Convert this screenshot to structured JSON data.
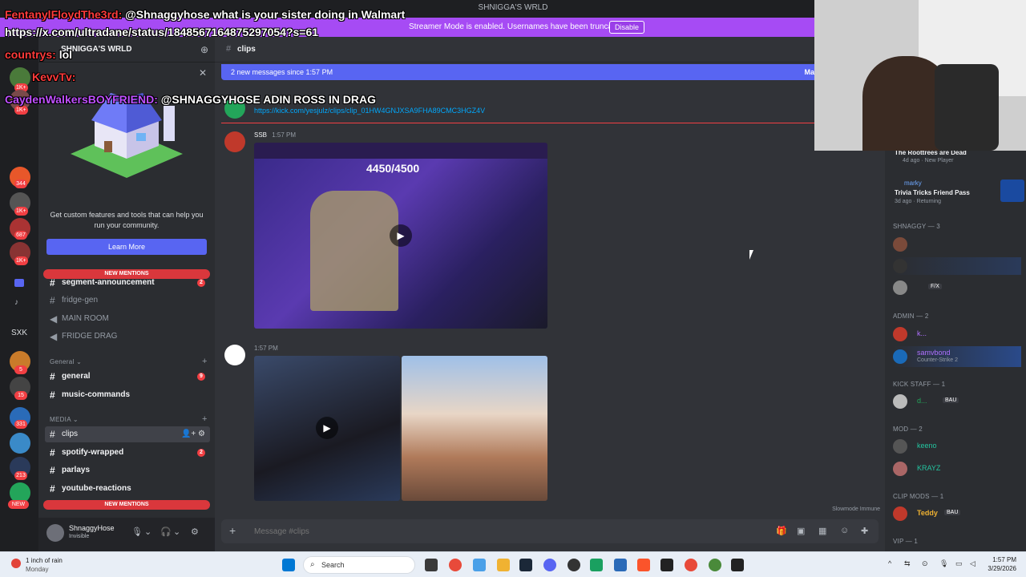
{
  "window": {
    "title": "SHNIGGA'S WRLD"
  },
  "streamer_banner": {
    "text": "Streamer Mode is enabled. Usernames have been truncated.",
    "button": "Disable"
  },
  "overlay_chat": [
    {
      "user": "FentanylFloydThe3rd:",
      "message": "@Shnaggyhose what is your sister doing in Walmart",
      "user_color": "#ff3b3b"
    },
    {
      "user": "",
      "message": "https://x.com/ultradane/status/1848567164875297054?s=61",
      "user_color": "#ffffff"
    },
    {
      "user": "countrys:",
      "message": "lol",
      "user_color": "#ff3b3b"
    },
    {
      "user": "KevvTv:",
      "message": "",
      "user_color": "#ff3b3b"
    },
    {
      "user": "CaydenWalkersBOYFRIEND:",
      "message": "@SHNAGGYHOSE ADIN ROSS IN DRAG",
      "user_color": "#c050ff"
    }
  ],
  "rail": {
    "badges": [
      "1K+",
      "1K+",
      "344",
      "1K+",
      "687",
      "1K+",
      "5",
      "15",
      "331",
      "213",
      "NEW"
    ],
    "text_server": "SXK"
  },
  "sidebar": {
    "server_name": "SHNIGGA'S WRLD",
    "promo_text": "Get custom features and tools that can help you run your community.",
    "promo_button": "Learn More",
    "new_mentions_label": "NEW MENTIONS",
    "channels_top": [
      {
        "name": "segment-announcement",
        "badge": "2",
        "type": "text",
        "bold": true
      },
      {
        "name": "fridge-gen",
        "badge": "",
        "type": "text",
        "bold": false
      },
      {
        "name": "MAIN ROOM",
        "badge": "",
        "type": "voice",
        "bold": false
      },
      {
        "name": "FRIDGE DRAG",
        "badge": "",
        "type": "voice",
        "bold": false
      }
    ],
    "cat_general": "General",
    "channels_general": [
      {
        "name": "general",
        "badge": "9",
        "bold": true
      },
      {
        "name": "music-commands",
        "badge": "",
        "bold": true
      }
    ],
    "cat_media": "MEDIA",
    "channels_media": [
      {
        "name": "clips",
        "badge": "",
        "bold": true,
        "selected": true
      },
      {
        "name": "spotify-wrapped",
        "badge": "2",
        "bold": true
      },
      {
        "name": "parlays",
        "badge": "",
        "bold": true
      },
      {
        "name": "youtube-reactions",
        "badge": "",
        "bold": true
      }
    ],
    "user": {
      "name": "ShnaggyHose",
      "status": "Invisible"
    }
  },
  "main": {
    "channel": "clips",
    "new_messages": "2 new messages since 1:57 PM",
    "mark_read": "Ma",
    "link": "https://kick.com/yesjulz/clips/clip_01HW4GNJXSA9FHA89CMC3HGZ4V",
    "msg1": {
      "author": "SSB",
      "time": "1:57 PM",
      "overlay_count": "4450/4500"
    },
    "msg2": {
      "time": "1:57 PM"
    },
    "slowmode": "Slowmode Immune",
    "composer_placeholder": "Message #clips"
  },
  "members": {
    "activity1": {
      "title": "The Roottrees are Dead",
      "time": "4d ago",
      "tag": "New Player"
    },
    "activity2": {
      "name": "marky",
      "title": "Trivia Tricks Friend Pass",
      "time": "3d ago",
      "tag": "Returning"
    },
    "groups": [
      {
        "label": "SHNAGGY — 3"
      },
      {
        "label": "ADMIN — 2"
      },
      {
        "label": "KICK STAFF — 1"
      },
      {
        "label": "MOD — 2"
      },
      {
        "label": "CLIP MODS — 1"
      },
      {
        "label": "VIP — 1"
      }
    ],
    "admin_member": {
      "name": "samvbond",
      "sub": "Counter-Strike 2"
    },
    "kick_member": {
      "name": "d...",
      "tag": "BAU"
    },
    "mods": [
      "keeno",
      "KRAYZ"
    ],
    "clip_mod": {
      "name": "Teddy",
      "tag": "BAU"
    },
    "shnaggy_member3_tag": "F/X",
    "admin1": "k..."
  },
  "taskbar": {
    "weather_1": "1 inch of rain",
    "weather_2": "Monday",
    "search": "Search",
    "time": "1:57 PM",
    "date": "3/29/2026"
  },
  "colors": {
    "accent": "#5865f2",
    "danger": "#f23f43",
    "streamer": "#a64bf4"
  }
}
